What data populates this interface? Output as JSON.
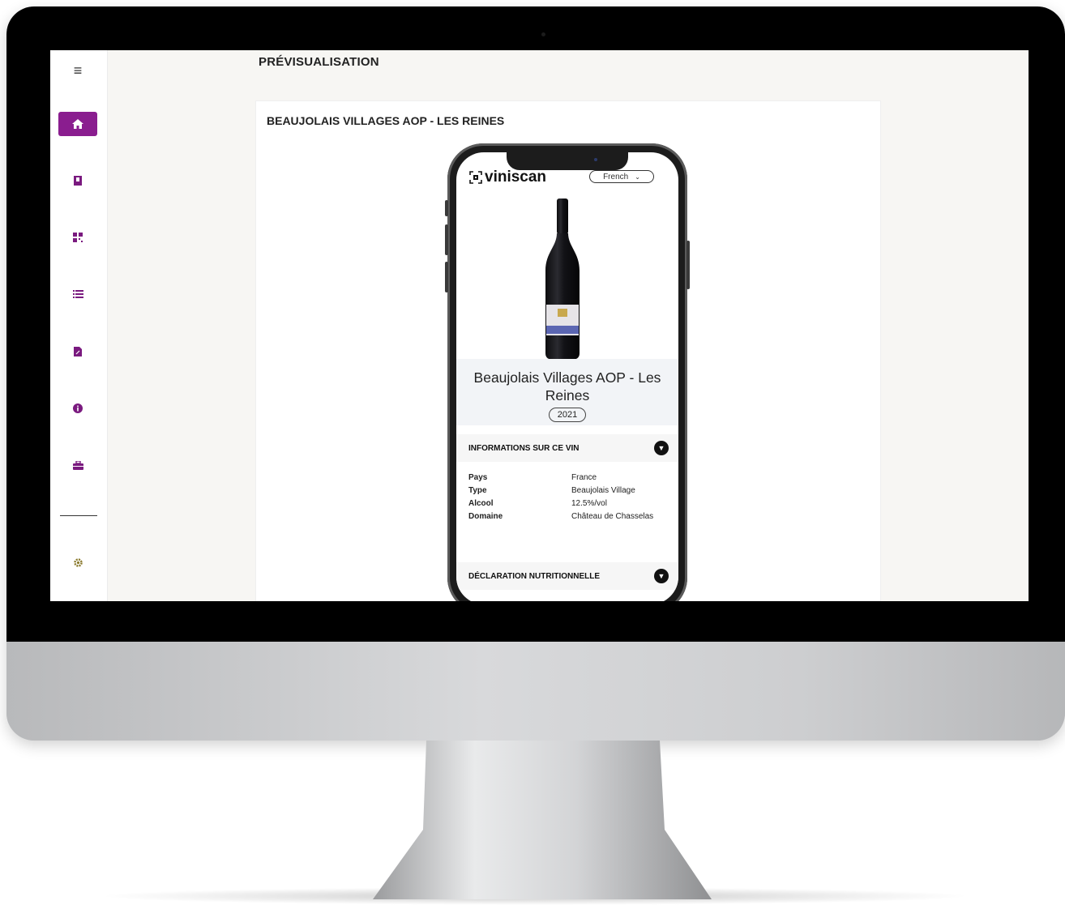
{
  "app": {
    "page_title": "PRÉVISUALISATION",
    "card_title": "BEAUJOLAIS VILLAGES AOP - LES REINES"
  },
  "sidebar": {
    "items": [
      {
        "name": "menu-icon"
      },
      {
        "name": "home-icon",
        "active": true
      },
      {
        "name": "bookmark-icon"
      },
      {
        "name": "qr-grid-icon"
      },
      {
        "name": "list-icon"
      },
      {
        "name": "pdf-icon"
      },
      {
        "name": "info-icon"
      },
      {
        "name": "briefcase-icon"
      },
      {
        "name": "gear-icon"
      }
    ]
  },
  "colors": {
    "accent": "#8a1d8f",
    "screen_bg": "#f7f6f3"
  },
  "phone": {
    "brand": "viniscan",
    "language": "French",
    "wine_name": "Beaujolais Villages AOP - Les Reines",
    "vintage": "2021",
    "section_info": "INFORMATIONS SUR CE VIN",
    "info_rows": [
      {
        "key": "Pays",
        "value": "France"
      },
      {
        "key": "Type",
        "value": "Beaujolais Village"
      },
      {
        "key": "Alcool",
        "value": "12.5%/vol"
      },
      {
        "key": "Domaine",
        "value": "Château de Chasselas"
      }
    ],
    "section_nutrition": "DÉCLARATION NUTRITIONNELLE"
  }
}
